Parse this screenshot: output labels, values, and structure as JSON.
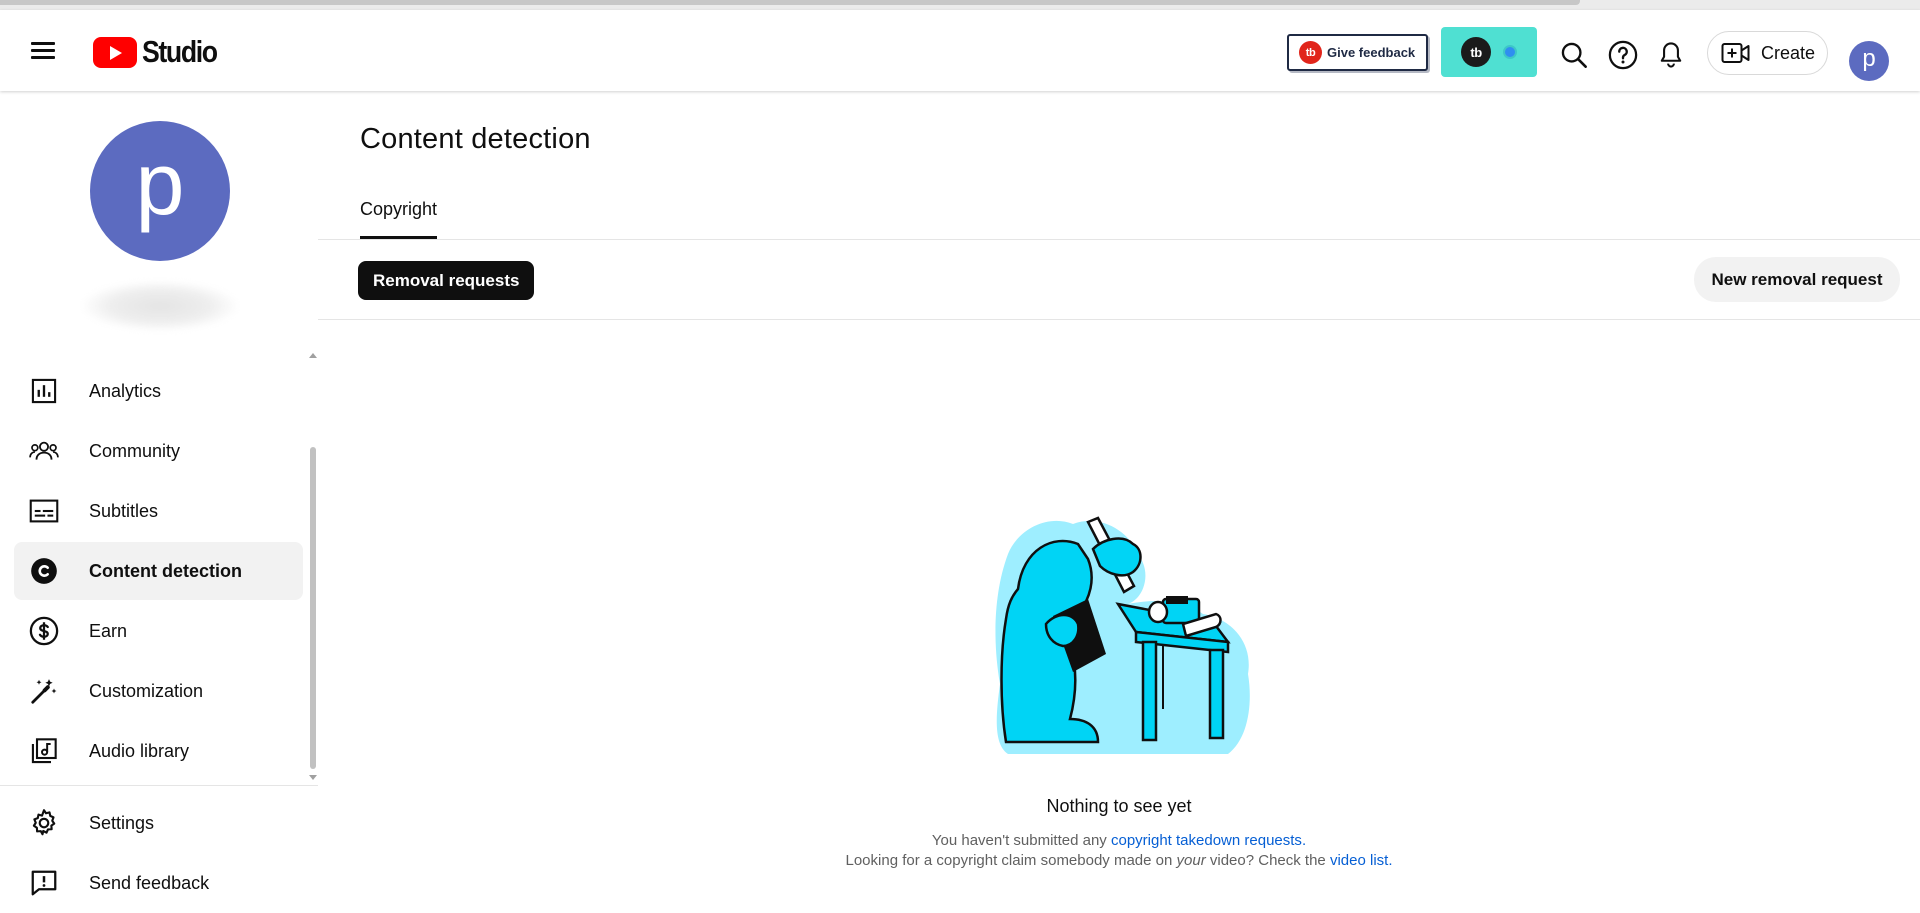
{
  "app": {
    "logo_text": "Studio",
    "feedback_label": "Give feedback",
    "feedback_logo": "tb",
    "ext_logo": "tb",
    "create_label": "Create",
    "avatar_letter": "p"
  },
  "sidebar": {
    "avatar_letter": "p",
    "items": [
      {
        "label": "Analytics",
        "icon": "analytics-icon"
      },
      {
        "label": "Community",
        "icon": "community-icon"
      },
      {
        "label": "Subtitles",
        "icon": "subtitles-icon"
      },
      {
        "label": "Content detection",
        "icon": "content-detection-icon",
        "active": true
      },
      {
        "label": "Earn",
        "icon": "earn-icon"
      },
      {
        "label": "Customization",
        "icon": "customization-icon"
      },
      {
        "label": "Audio library",
        "icon": "audio-library-icon"
      }
    ],
    "footer_items": [
      {
        "label": "Settings",
        "icon": "gear-icon"
      },
      {
        "label": "Send feedback",
        "icon": "feedback-icon"
      }
    ]
  },
  "main": {
    "title": "Content detection",
    "tabs": [
      {
        "label": "Copyright",
        "active": true
      }
    ],
    "filter_chip": "Removal requests",
    "new_request_button": "New removal request",
    "empty_state": {
      "title": "Nothing to see yet",
      "line1_prefix": "You haven't submitted any ",
      "line1_link": "copyright takedown requests",
      "line1_suffix": ".",
      "line2_prefix": "Looking for a copyright claim somebody made on ",
      "line2_emph": "your",
      "line2_middle": " video? Check the ",
      "line2_link": "video list",
      "line2_suffix": "."
    }
  },
  "colors": {
    "brand_red": "#ff0000",
    "avatar": "#5c6bc0",
    "link": "#065fd4",
    "illustration_cyan": "#00d4f5",
    "illustration_halo": "#9eeeff"
  }
}
